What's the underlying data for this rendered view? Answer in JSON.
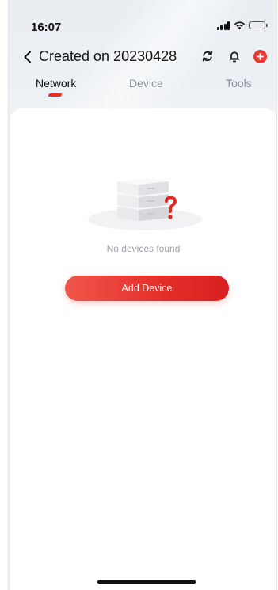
{
  "status_bar": {
    "time": "16:07",
    "icons": [
      "signal-icon",
      "wifi-icon",
      "battery-icon"
    ]
  },
  "nav": {
    "back_icon": "chevron-left-icon",
    "title": "Created on 20230428",
    "actions": [
      "refresh-icon",
      "bell-icon",
      "add-circle-icon"
    ]
  },
  "tabs": [
    {
      "label": "Network",
      "active": true
    },
    {
      "label": "Device",
      "active": false
    },
    {
      "label": "Tools",
      "active": false
    }
  ],
  "empty_state": {
    "illustration": "server-question-icon",
    "message": "No devices found",
    "button_label": "Add Device"
  },
  "colors": {
    "accent": "#e8322e",
    "active_tab_text": "#111111",
    "inactive_tab_text": "#8a8f98",
    "empty_text": "#9a9ea6"
  }
}
